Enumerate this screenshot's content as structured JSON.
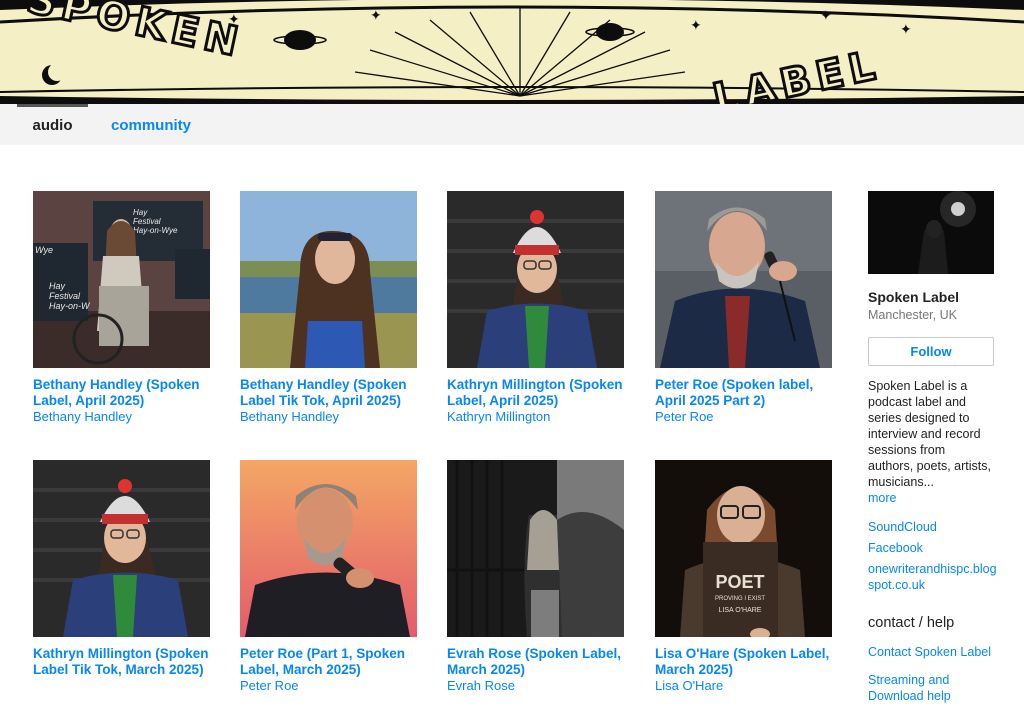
{
  "banner": {
    "word_left": "SPOKEN",
    "word_right": "LABEL",
    "colors": {
      "paper": "#f4efc4",
      "ink": "#0d0d0d"
    }
  },
  "tabs": {
    "audio": "audio",
    "community": "community"
  },
  "releases": [
    {
      "title": "Bethany Handley (Spoken Label, April 2025)",
      "artist": "Bethany Handley"
    },
    {
      "title": "Bethany Handley (Spoken Label Tik Tok, April 2025)",
      "artist": "Bethany Handley"
    },
    {
      "title": "Kathryn Millington (Spoken Label, April 2025)",
      "artist": "Kathryn Millington"
    },
    {
      "title": "Peter Roe (Spoken label, April 2025 Part 2)",
      "artist": "Peter Roe"
    },
    {
      "title": "Kathryn Millington (Spoken Label Tik Tok, March 2025)",
      "artist": ""
    },
    {
      "title": "Peter Roe (Part 1, Spoken Label, March 2025)",
      "artist": "Peter Roe"
    },
    {
      "title": "Evrah Rose (Spoken Label, March 2025)",
      "artist": "Evrah Rose"
    },
    {
      "title": "Lisa O'Hare (Spoken Label, March 2025)",
      "artist": "Lisa O'Hare"
    }
  ],
  "cover_text": {
    "hay_1": "Hay",
    "festival_1": "Festival",
    "hayonwye_1": "Hay-on-Wye",
    "wye": "Wye",
    "hay_2": "Hay",
    "festival_2": "Festival",
    "hayonwye_2": "Hay-on-W",
    "book_title": "POET",
    "book_subtitle": "PROVING I EXIST",
    "book_author": "LISA O'HARE"
  },
  "sidebar": {
    "name": "Spoken Label",
    "location": "Manchester, UK",
    "follow": "Follow",
    "bio": "Spoken Label is a podcast label and series designed to interview and record sessions from authors, poets, artists, musicians...",
    "more": "more",
    "links": {
      "soundcloud": "SoundCloud",
      "facebook": "Facebook",
      "blog": "onewriterandhispc.blogspot.co.uk"
    },
    "contact_heading": "contact / help",
    "contact_link": "Contact Spoken Label",
    "help_link": "Streaming and Download help"
  },
  "colors": {
    "link": "#0687f5",
    "tabbar": "#f3f3f3"
  }
}
